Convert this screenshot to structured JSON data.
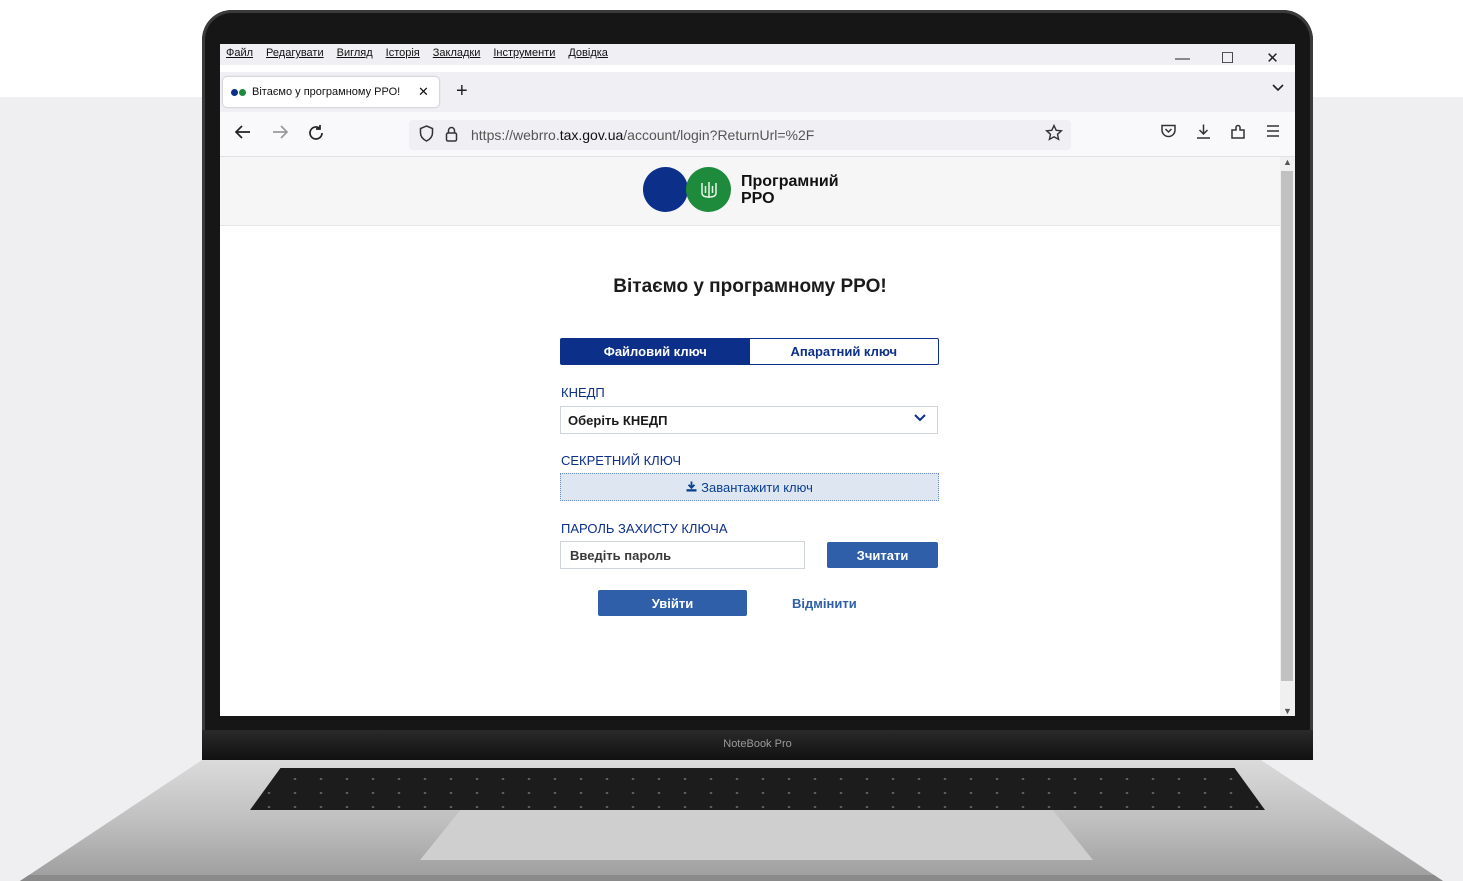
{
  "device": {
    "label": "NoteBook Pro"
  },
  "menubar": {
    "items": [
      "Файл",
      "Редагувати",
      "Вигляд",
      "Історія",
      "Закладки",
      "Інструменти",
      "Довідка"
    ]
  },
  "window_controls": {
    "minimize": "—",
    "maximize": "☐",
    "close": "✕"
  },
  "tab": {
    "title": "Вітаємо у програмному РРО!",
    "close": "✕"
  },
  "tabbar": {
    "new_tab": "+",
    "list_tabs": "⌄"
  },
  "urlbar": {
    "prefix": "https://webrro.",
    "domain": "tax.gov.ua",
    "path": "/account/login?ReturnUrl=%2F"
  },
  "icons": {
    "back": "back-arrow-icon",
    "forward": "forward-arrow-icon",
    "reload": "reload-icon",
    "shield": "shield-icon",
    "lock": "lock-icon",
    "bookmark": "star-icon",
    "pocket": "pocket-icon",
    "downloads": "download-icon",
    "extensions": "extensions-icon",
    "menu": "hamburger-menu-icon"
  },
  "logo": {
    "text": "Програмний\nРРО"
  },
  "page": {
    "heading": "Вітаємо у програмному РРО!",
    "tabs": [
      "Файловий ключ",
      "Апаратний ключ"
    ],
    "active_tab": "Файловий ключ",
    "kedp_label": "КНЕДП",
    "kedp_value": "Оберіть КНЕДП",
    "secret_label": "СЕКРЕТНИЙ КЛЮЧ",
    "upload_label": "Завантажити ключ",
    "password_label": "ПАРОЛЬ ЗАХИСТУ КЛЮЧА",
    "password_placeholder": "Введіть пароль",
    "read_button": "Зчитати",
    "login_button": "Увійти",
    "cancel_link": "Відмінити"
  },
  "colors": {
    "brand_blue": "#0c2f8a",
    "button_blue": "#2f5fa8",
    "brand_green": "#1e8a3c"
  }
}
